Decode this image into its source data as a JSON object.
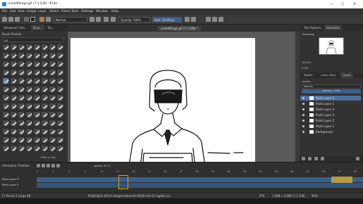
{
  "window": {
    "title": "ismellthings.gif (7.1 GiB) - Krita",
    "minimize": "—",
    "maximize": "☐",
    "close": "✕"
  },
  "menu": [
    "File",
    "Edit",
    "View",
    "Image",
    "Layer",
    "Select",
    "Filters",
    "Tools",
    "Settings",
    "Window",
    "Help"
  ],
  "toolbar": {
    "blend_mode": "Normal",
    "opacity": "Opacity: 100%",
    "size": "Size: 20.00 px"
  },
  "left_dock": {
    "tabs": [
      "Advanced Colo...",
      "Brus...",
      "Too..."
    ],
    "title": "Brush Presets",
    "filter": "All",
    "tag_label": "Filter in Tag"
  },
  "canvas": {
    "tab_title": "ismellthings.gif (7.1 GiB) *"
  },
  "right_dock": {
    "tabs": [
      "Tool Options",
      "Overview"
    ],
    "overview_title": "Overview",
    "zoom": "100.0%",
    "rotation": "0.00°",
    "subtabs": [
      "Palette",
      "Onion Skins",
      "Layers"
    ],
    "layers_title": "Layers",
    "blend": "Normal",
    "opacity": "Opacity: 100%",
    "layers": [
      "Paint Layer 6",
      "Paint Layer 5",
      "Paint Layer 4",
      "Paint Layer 3",
      "Paint Layer 2",
      "Paint Layer 1",
      "Background"
    ]
  },
  "timeline": {
    "title": "Animation Timeline",
    "speed": "speed: 50 %",
    "tracks": [
      "Paint Layer 6",
      "Paint Layer 5"
    ],
    "ticks": [
      "0",
      "3",
      "6",
      "9",
      "12",
      "15",
      "18",
      "21",
      "24",
      "27",
      "30",
      "33",
      "36",
      "39",
      "42",
      "45",
      "48",
      "51",
      "54",
      "57",
      "60"
    ]
  },
  "status": {
    "brush": "C) Pencil-3 Large 4B",
    "color": "RGB/Alpha (8-bit integer/channel)  sRGB-elle-V2-srgbtrc.icc",
    "size": "1,908 x 2,868 (7.1 GiB)",
    "zoom": "50%",
    "fps": "FPS"
  },
  "colors": {
    "accent": "#4d6e9c",
    "frames": "#3d5f86"
  }
}
